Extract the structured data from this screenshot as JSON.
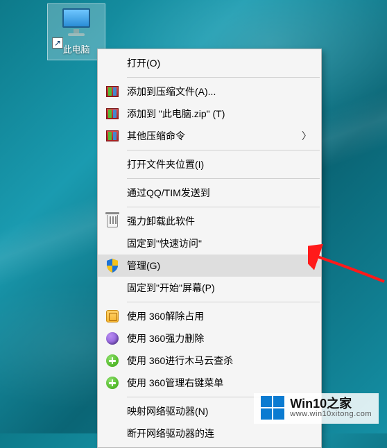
{
  "desktop_icon": {
    "label": "此电脑"
  },
  "menu": {
    "open": "打开(O)",
    "archive_add": "添加到压缩文件(A)...",
    "archive_zip": "添加到 \"此电脑.zip\" (T)",
    "archive_other": "其他压缩命令",
    "open_location": "打开文件夹位置(I)",
    "send_qq": "通过QQ/TIM发送到",
    "force_uninstall": "强力卸载此软件",
    "pin_quick": "固定到\"快速访问\"",
    "manage": "管理(G)",
    "pin_start": "固定到\"开始\"屏幕(P)",
    "p360_unlock": "使用 360解除占用",
    "p360_delete": "使用 360强力删除",
    "p360_scan": "使用 360进行木马云查杀",
    "p360_menu": "使用 360管理右键菜单",
    "map_drive": "映射网络驱动器(N)",
    "disconnect_drive": "断开网络驱动器的连"
  },
  "watermark": {
    "title": "Win10之家",
    "url": "www.win10xitong.com"
  }
}
